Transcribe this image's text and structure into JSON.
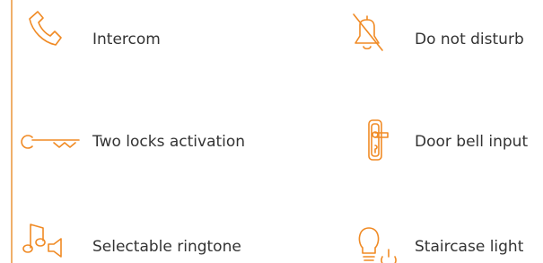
{
  "accent_color": "#f08a24",
  "text_color": "#333333",
  "features": {
    "intercom": {
      "label": "Intercom",
      "icon": "phone-handset-icon"
    },
    "two_locks": {
      "label": "Two locks activation",
      "icon": "key-icon"
    },
    "ringtone": {
      "label": "Selectable ringtone",
      "icon": "music-note-speaker-icon"
    },
    "do_not_disturb": {
      "label": "Do not disturb",
      "icon": "bell-off-icon"
    },
    "door_bell": {
      "label": "Door bell input",
      "icon": "door-handle-icon"
    },
    "staircase": {
      "label": "Staircase light",
      "icon": "light-bulb-power-icon"
    }
  }
}
